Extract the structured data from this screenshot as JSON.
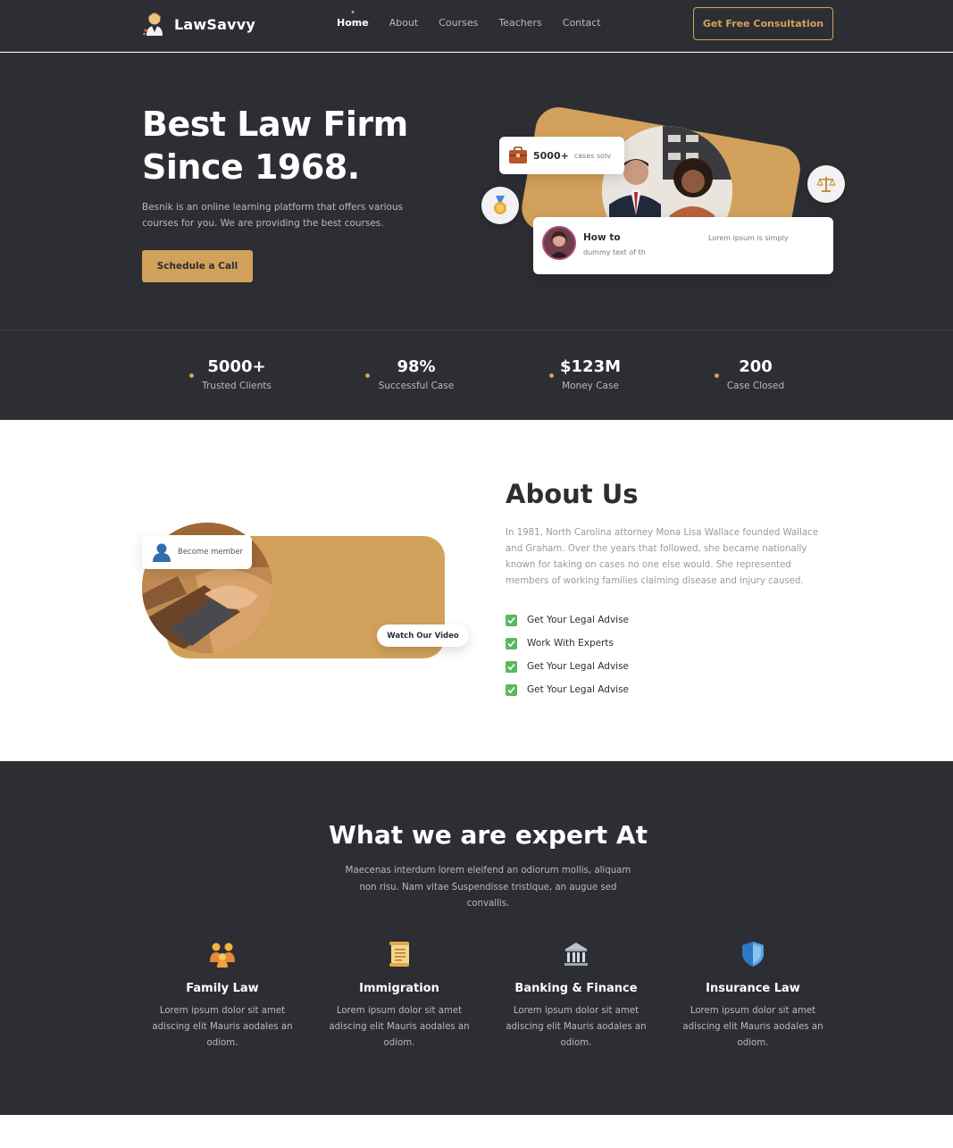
{
  "brand": {
    "name": "LawSavvy"
  },
  "nav": {
    "items": [
      {
        "label": "Home",
        "active": true
      },
      {
        "label": "About",
        "active": false
      },
      {
        "label": "Courses",
        "active": false
      },
      {
        "label": "Teachers",
        "active": false
      },
      {
        "label": "Contact",
        "active": false
      }
    ],
    "cta": "Get Free Consultation"
  },
  "hero": {
    "title": "Best Law Firm Since 1968.",
    "subtitle": "Besnik is an online learning platform that offers various courses for you. We are providing the best courses.",
    "button": "Schedule a Call",
    "cases_count": "5000+",
    "cases_label": "cases solv",
    "testimonial_title": "How to",
    "testimonial_text_right": "Lorem ipsum is simply",
    "testimonial_text": "dummy text of th"
  },
  "stats": [
    {
      "value": "5000+",
      "label": "Trusted Clients"
    },
    {
      "value": "98%",
      "label": "Successful Case"
    },
    {
      "value": "$123M",
      "label": "Money Case"
    },
    {
      "value": "200",
      "label": "Case Closed"
    }
  ],
  "about": {
    "member_label": "Become member",
    "video_label": "Watch Our Video",
    "title": "About Us",
    "text": "In 1981, North Carolina attorney Mona Lisa Wallace founded Wallace and Graham. Over the years that followed, she became nationally known for taking on cases no one else would. She represented members of working families claiming disease and injury caused.",
    "checklist": [
      "Get Your Legal Advise",
      "Work With Experts",
      "Get Your Legal Advise",
      "Get Your Legal Advise"
    ]
  },
  "expert": {
    "title": "What we are expert At",
    "subtitle": "Maecenas interdum lorem eleifend an odiorum mollis, aliquam non risu. Nam vitae Suspendisse tristique, an augue sed convallis.",
    "cards": [
      {
        "icon": "family-icon",
        "title": "Family Law",
        "text": "Lorem ipsum dolor sit amet adiscing elit Mauris aodales an odiom."
      },
      {
        "icon": "scroll-icon",
        "title": "Immigration",
        "text": "Lorem ipsum dolor sit amet adiscing elit Mauris aodales an odiom."
      },
      {
        "icon": "bank-icon",
        "title": "Banking & Finance",
        "text": "Lorem ipsum dolor sit amet adiscing elit Mauris aodales an odiom."
      },
      {
        "icon": "shield-icon",
        "title": "Insurance Law",
        "text": "Lorem ipsum dolor sit amet adiscing elit Mauris aodales an odiom."
      }
    ]
  },
  "colors": {
    "dark": "#2d2e33",
    "gold": "#d2a15c",
    "check": "#5cb85c"
  }
}
